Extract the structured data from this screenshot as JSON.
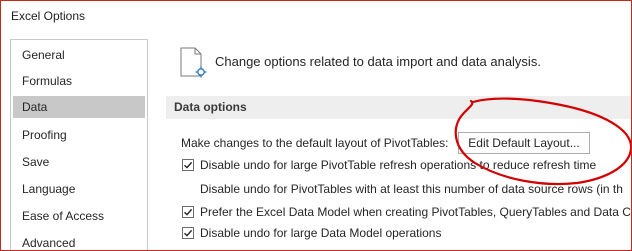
{
  "window": {
    "title": "Excel Options"
  },
  "sidebar": {
    "items": [
      {
        "label": "General",
        "selected": false
      },
      {
        "label": "Formulas",
        "selected": false
      },
      {
        "label": "Data",
        "selected": true
      },
      {
        "label": "Proofing",
        "selected": false
      },
      {
        "label": "Save",
        "selected": false
      },
      {
        "label": "Language",
        "selected": false
      },
      {
        "label": "Ease of Access",
        "selected": false
      },
      {
        "label": "Advanced",
        "selected": false
      }
    ]
  },
  "main": {
    "heading": "Change options related to data import and data analysis.",
    "heading_icon": "document-options-icon",
    "section_title": "Data options",
    "layout_label": "Make changes to the default layout of PivotTables:",
    "edit_layout_button": "Edit Default Layout...",
    "options": [
      {
        "label": "Disable undo for large PivotTable refresh operations to reduce refresh time",
        "checked": true
      },
      {
        "label": "Disable undo for PivotTables with at least this number of data source rows (in th",
        "checked": null
      },
      {
        "label": "Prefer the Excel Data Model when creating PivotTables, QueryTables and Data C",
        "checked": true
      },
      {
        "label": "Disable undo for large Data Model operations",
        "checked": true
      }
    ]
  },
  "colors": {
    "window_border": "#c42b1c",
    "selected_nav": "#c8c8c8",
    "section_bar": "#eeeeee",
    "annotation": "#d40000"
  },
  "annotation": {
    "shape": "freehand-circle",
    "color": "#d40000"
  }
}
